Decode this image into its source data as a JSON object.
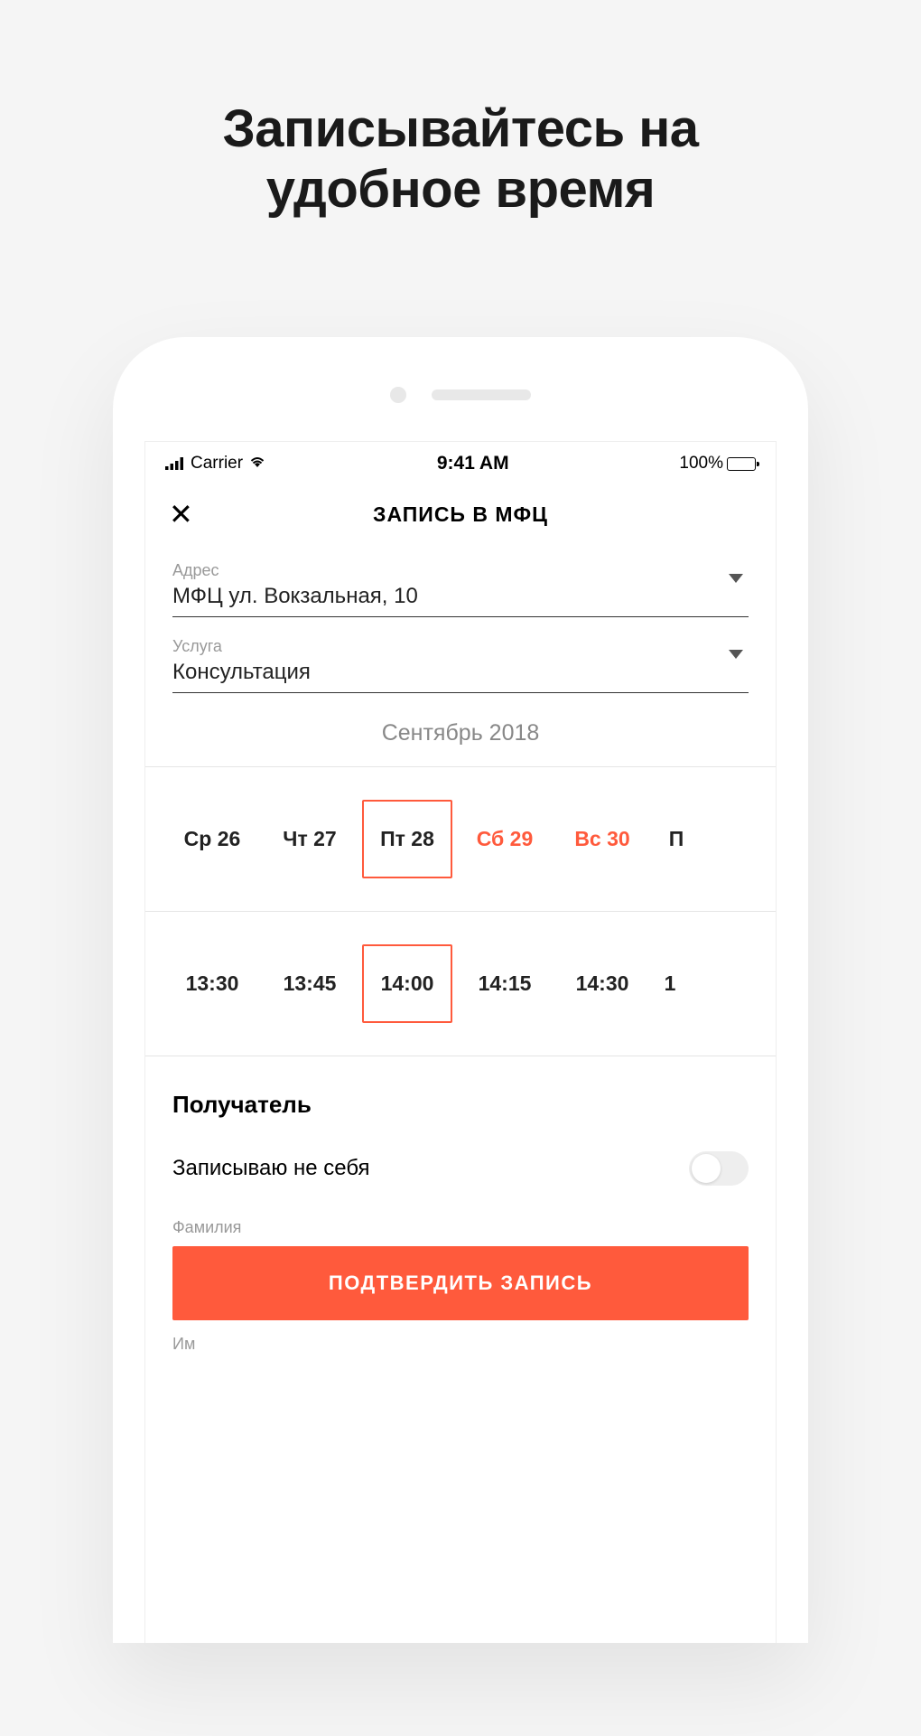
{
  "promo": {
    "title_line1": "Записывайтесь на",
    "title_line2": "удобное время"
  },
  "status_bar": {
    "carrier": "Carrier",
    "time": "9:41 AM",
    "battery": "100%"
  },
  "nav": {
    "title": "ЗАПИСЬ В МФЦ"
  },
  "form": {
    "address_label": "Адрес",
    "address_value": "МФЦ ул. Вокзальная, 10",
    "service_label": "Услуга",
    "service_value": "Консультация"
  },
  "calendar": {
    "month": "Сентябрь 2018",
    "dates": [
      {
        "label": "Ср 26",
        "weekend": false,
        "selected": false
      },
      {
        "label": "Чт 27",
        "weekend": false,
        "selected": false
      },
      {
        "label": "Пт 28",
        "weekend": false,
        "selected": true
      },
      {
        "label": "Сб 29",
        "weekend": true,
        "selected": false
      },
      {
        "label": "Вс 30",
        "weekend": true,
        "selected": false
      },
      {
        "label": "П",
        "weekend": false,
        "selected": false,
        "partial": true
      }
    ],
    "times": [
      {
        "label": "13:30",
        "selected": false
      },
      {
        "label": "13:45",
        "selected": false
      },
      {
        "label": "14:00",
        "selected": true
      },
      {
        "label": "14:15",
        "selected": false
      },
      {
        "label": "14:30",
        "selected": false
      },
      {
        "label": "1",
        "selected": false,
        "partial": true
      }
    ]
  },
  "recipient": {
    "section_title": "Получатель",
    "toggle_label": "Записываю не себя",
    "lastname_label": "Фамилия",
    "name_partial": "Им"
  },
  "cta": {
    "confirm": "ПОДТВЕРДИТЬ ЗАПИСЬ"
  }
}
